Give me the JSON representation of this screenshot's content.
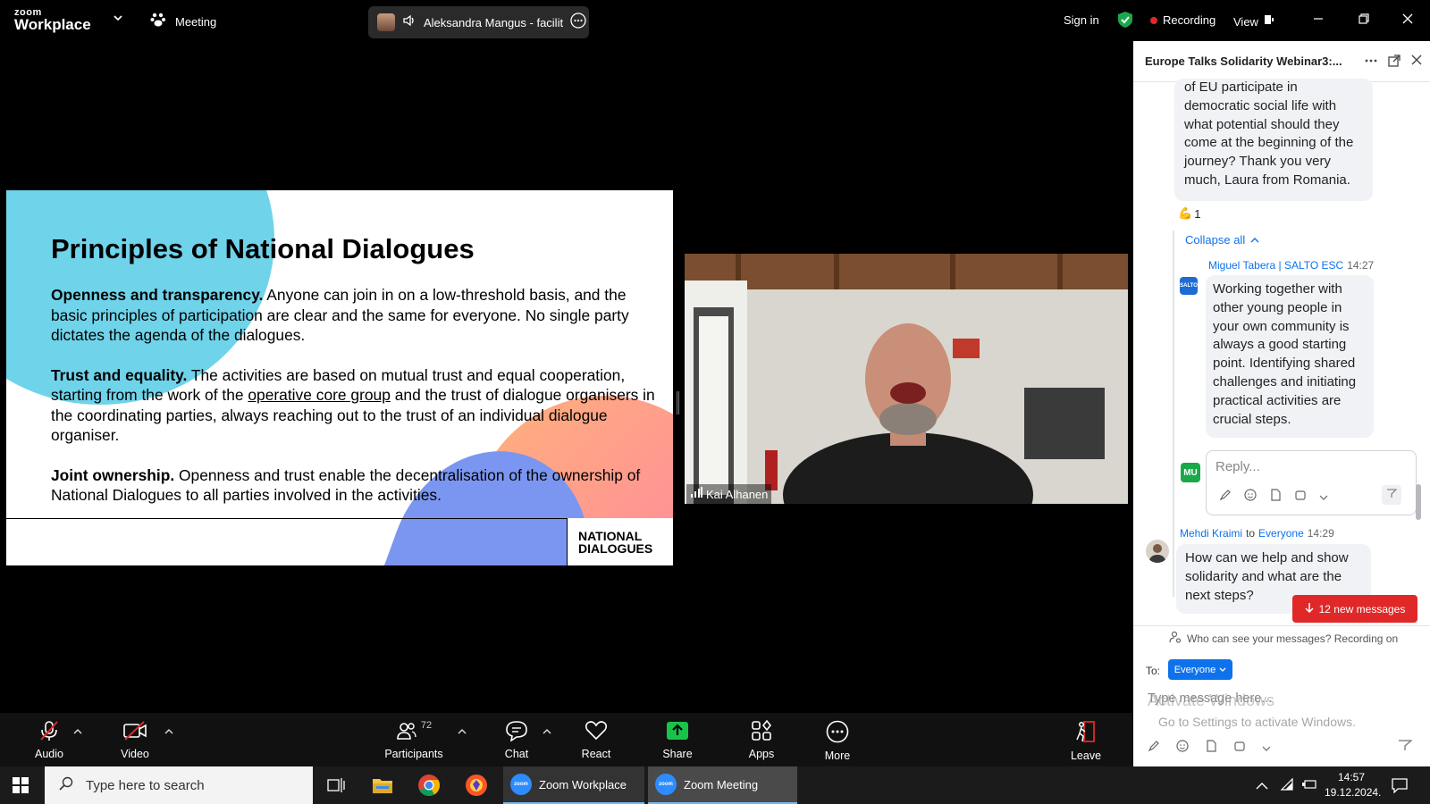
{
  "topbar": {
    "logo_small": "zoom",
    "logo_big": "Workplace",
    "meeting_label": "Meeting",
    "speaker_name": "Aleksandra Mangus - facilita",
    "sign_in": "Sign in",
    "recording": "Recording",
    "view": "View"
  },
  "slide": {
    "title": "Principles of National Dialogues",
    "p1_bold": "Openness and transparency.",
    "p1_text": " Anyone can join in on a low-threshold basis, and the basic principles of participation are clear and the same for everyone. No single party dictates the agenda of the dialogues.",
    "p2_bold": "Trust and equality.",
    "p2_text_a": " The activities are based on mutual trust and equal cooperation, starting from the work of the ",
    "p2_link": "operative core group",
    "p2_text_b": " and the trust of dialogue organisers in the coordinating parties, always reaching out to the trust of an individual dialogue organiser.",
    "p3_bold": "Joint ownership.",
    "p3_text": " Openness and trust enable the decentralisation of the ownership of National Dialogues to all parties involved in the activities.",
    "brand_line1": "NATIONAL",
    "brand_line2": "DIALOGUES"
  },
  "video": {
    "participant_name": "Kai Alhanen"
  },
  "chat": {
    "title": "Europe Talks Solidarity Webinar3:...",
    "prev_message": "of EU participate in democratic social life with what potential should they come at the beginning of the journey?  Thank you very much, Laura from Romania.",
    "reaction_emoji": "💪",
    "reaction_count": "1",
    "collapse_all": "Collapse all",
    "reply_sender": "Miguel Tabera | SALTO ESC",
    "reply_time": "14:27",
    "reply_avatar": "SALTO",
    "reply_text": "Working together with other young people in your own community is always a good starting point. Identifying shared challenges and initiating practical activities are crucial steps.",
    "reply_input_avatar": "MU",
    "reply_placeholder": "Reply...",
    "msg_sender": "Mehdi Kraimi",
    "msg_to_word": "to",
    "msg_to": "Everyone",
    "msg_time": "14:29",
    "msg_text": "How can we help and show solidarity and what are the next steps?",
    "new_messages": "12 new messages",
    "visibility_note": "Who can see your messages? Recording on",
    "to_label": "To:",
    "to_value": "Everyone",
    "input_placeholder": "Type message here...",
    "watermark_line1": "Activate Windows",
    "watermark_line2": "Go to Settings to activate Windows."
  },
  "toolbar": {
    "audio": "Audio",
    "video": "Video",
    "participants": "Participants",
    "participants_count": "72",
    "chat": "Chat",
    "react": "React",
    "share": "Share",
    "apps": "Apps",
    "more": "More",
    "leave": "Leave"
  },
  "taskbar": {
    "search_placeholder": "Type here to search",
    "app1": "Zoom Workplace",
    "app2": "Zoom Meeting",
    "zoom_icon_text": "zoom",
    "time": "14:57",
    "date": "19.12.2024."
  }
}
